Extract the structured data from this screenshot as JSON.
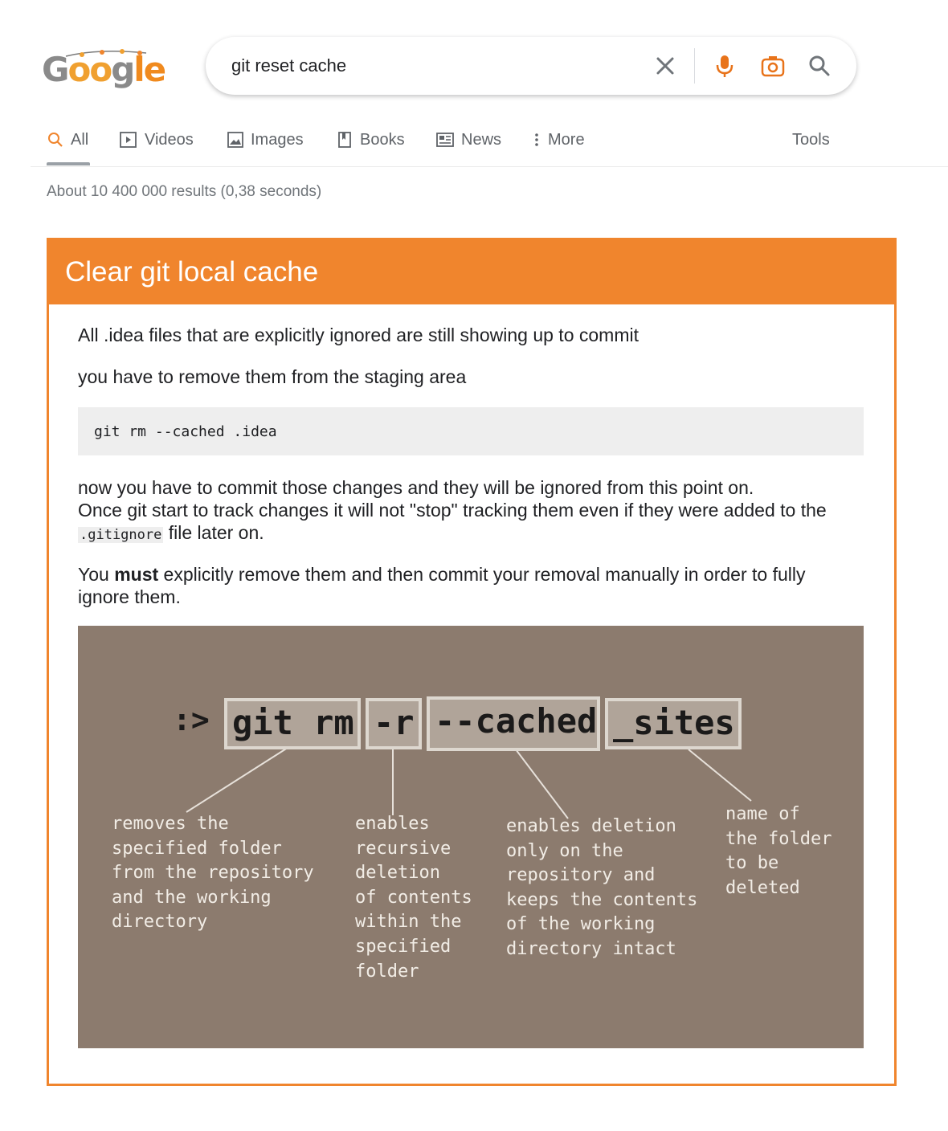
{
  "logo": {
    "alt": "Google"
  },
  "search": {
    "query": "git reset cache",
    "icons": [
      "close-icon",
      "microphone-icon",
      "camera-icon",
      "search-icon"
    ]
  },
  "tabs": [
    {
      "label": "All",
      "icon": "search-icon",
      "active": true
    },
    {
      "label": "Videos",
      "icon": "play-icon"
    },
    {
      "label": "Images",
      "icon": "image-icon"
    },
    {
      "label": "Books",
      "icon": "book-icon"
    },
    {
      "label": "News",
      "icon": "newspaper-icon"
    },
    {
      "label": "More",
      "icon": "more-vert-icon"
    }
  ],
  "tools_label": "Tools",
  "result_stats": "About 10 400 000 results (0,38 seconds)",
  "snippet": {
    "title": "Clear git local cache",
    "p1": "All .idea files that are explicitly ignored are still showing up to commit",
    "p2": "you have to remove them from the staging area",
    "code": "git rm --cached .idea",
    "p3_line1": "now you have to commit those changes and they will be ignored from this point on.",
    "p3_line2": "Once git start to track changes it will not \"stop\" tracking them even if they were added to the",
    "p3_code": ".gitignore",
    "p3_tail": " file later on.",
    "p4_pre": "You ",
    "p4_bold": "must",
    "p4_post": " explicitly remove them and then commit your removal manually in order to fully",
    "p4_line2": "ignore them.",
    "figure": {
      "prompt": ":>",
      "cmd": [
        "git rm",
        "-r",
        "--cached",
        "_sites"
      ],
      "desc": [
        "removes the\nspecified folder\nfrom the repository\nand the working\ndirectory",
        "enables\nrecursive\ndeletion\nof contents\nwithin the\nspecified\nfolder",
        "enables deletion\nonly on the\nrepository and\nkeeps the contents\nof the working\ndirectory intact",
        "name of\nthe folder\nto be\ndeleted"
      ]
    }
  },
  "colors": {
    "accent": "#f0852d",
    "figure_bg": "#8c7b6e"
  }
}
